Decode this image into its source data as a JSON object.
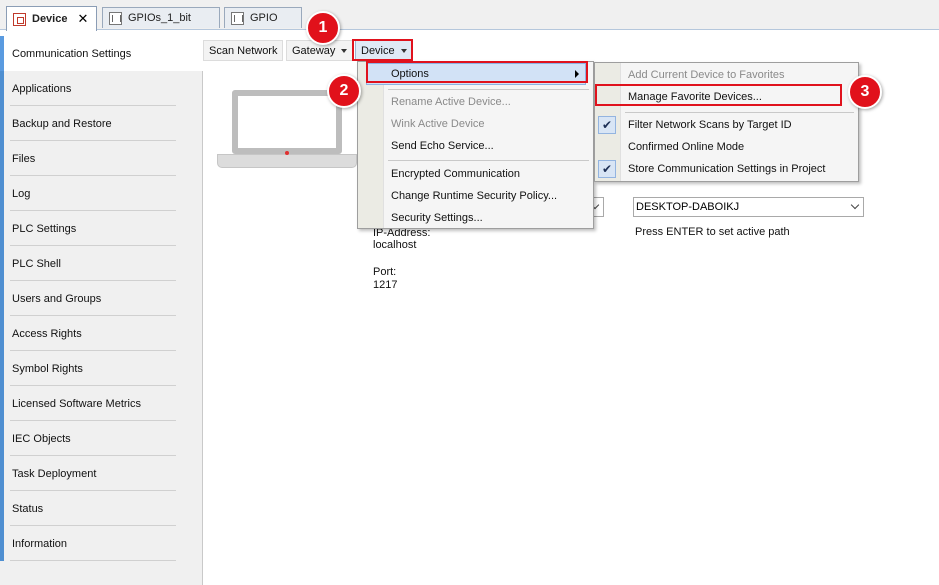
{
  "tabs": [
    {
      "label": "Device",
      "active": true,
      "icon": "device-icon"
    },
    {
      "label": "GPIOs_1_bit",
      "active": false,
      "icon": "grid-icon"
    },
    {
      "label": "GPIO",
      "active": false,
      "icon": "grid-icon"
    }
  ],
  "sidebar": {
    "items": [
      {
        "label": "Communication Settings",
        "active": true
      },
      {
        "label": "Applications"
      },
      {
        "label": "Backup and Restore"
      },
      {
        "label": "Files"
      },
      {
        "label": "Log"
      },
      {
        "label": "PLC Settings"
      },
      {
        "label": "PLC Shell"
      },
      {
        "label": "Users and Groups"
      },
      {
        "label": "Access Rights"
      },
      {
        "label": "Symbol Rights"
      },
      {
        "label": "Licensed Software Metrics"
      },
      {
        "label": "IEC Objects"
      },
      {
        "label": "Task Deployment"
      },
      {
        "label": "Status"
      },
      {
        "label": "Information"
      }
    ]
  },
  "toolbar": {
    "scan_network": "Scan Network",
    "gateway": "Gateway",
    "device": "Device"
  },
  "content": {
    "device_combo_value": "DESKTOP-DABOIKJ",
    "hint": "Press ENTER to set active path",
    "ip_label": "IP-Address:",
    "ip_value": "localhost",
    "port_label": "Port:",
    "port_value": "1217"
  },
  "device_menu": {
    "items": [
      {
        "label": "Options",
        "highlighted": true,
        "submenu": true
      },
      {
        "label": "Rename Active Device...",
        "disabled": true
      },
      {
        "label": "Wink Active Device",
        "disabled": true
      },
      {
        "label": "Send Echo Service..."
      },
      {
        "label": "Encrypted Communication"
      },
      {
        "label": "Change Runtime Security Policy..."
      },
      {
        "label": "Security Settings..."
      }
    ]
  },
  "options_menu": {
    "items": [
      {
        "label": "Add Current Device to Favorites",
        "disabled": true
      },
      {
        "label": "Manage Favorite Devices..."
      },
      {
        "label": "Filter Network Scans by Target ID",
        "checked": true
      },
      {
        "label": "Confirmed Online Mode"
      },
      {
        "label": "Store Communication Settings in Project",
        "checked": true
      }
    ]
  },
  "annotations": {
    "badges": [
      "1",
      "2",
      "3"
    ],
    "color": "#e1111b"
  },
  "colors": {
    "accent": "#4f8fd1",
    "menu_highlight": "#d2e2f6",
    "annotation_red": "#e0121d"
  }
}
